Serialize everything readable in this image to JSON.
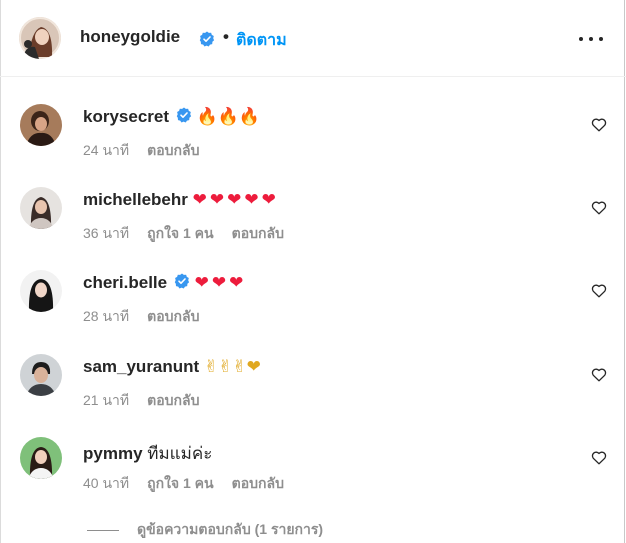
{
  "header": {
    "username": "honeygoldie",
    "separator": "•",
    "follow_label": "ติดตาม"
  },
  "comments": [
    {
      "username": "korysecret",
      "verified": true,
      "text": "🔥🔥🔥",
      "time": "24 นาที",
      "likes": "",
      "reply": "ตอบกลับ"
    },
    {
      "username": "michellebehr",
      "verified": false,
      "text": "❤❤❤❤❤",
      "time": "36 นาที",
      "likes": "ถูกใจ 1 คน",
      "reply": "ตอบกลับ"
    },
    {
      "username": "cheri.belle",
      "verified": true,
      "text": "❤❤❤",
      "time": "28 นาที",
      "likes": "",
      "reply": "ตอบกลับ"
    },
    {
      "username": "sam_yuranunt",
      "verified": false,
      "text": "✌✌✌❤",
      "time": "21 นาที",
      "likes": "",
      "reply": "ตอบกลับ"
    },
    {
      "username": "pymmy",
      "verified": false,
      "text": "ทีมแม่ค่ะ",
      "time": "40 นาที",
      "likes": "ถูกใจ 1 คน",
      "reply": "ตอบกลับ"
    }
  ],
  "view_replies": "ดูข้อความตอบกลับ (1 รายการ)",
  "colors": {
    "accent": "#0095f6",
    "verified": "#3897f0",
    "muted": "#8e8e8e",
    "heart_red": "#ed1c3c"
  }
}
